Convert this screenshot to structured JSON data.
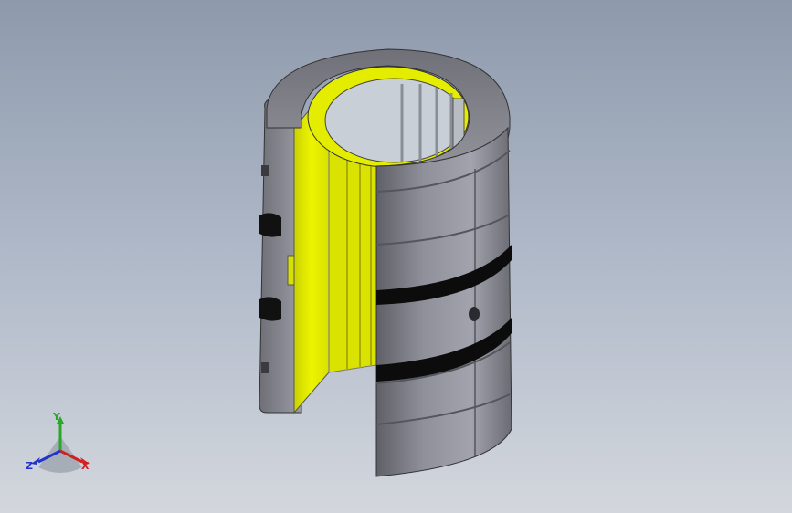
{
  "viewport": {
    "background_top": "#8e9aac",
    "background_bottom": "#d3d7dd",
    "model": "linear-bearing-section-view",
    "colors": {
      "housing": "#8c8c96",
      "insert": "#e6f000",
      "groove": "#111111"
    }
  },
  "triad": {
    "x_label": "X",
    "y_label": "Y",
    "z_label": "Z",
    "x_color": "#d02020",
    "y_color": "#2aa62a",
    "z_color": "#2233cc"
  }
}
